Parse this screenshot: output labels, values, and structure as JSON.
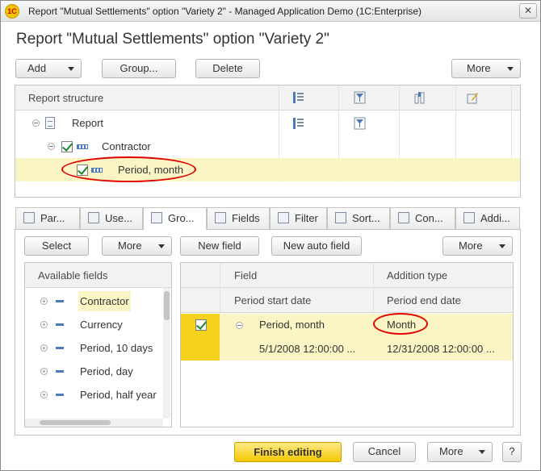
{
  "window": {
    "app_icon": "1С",
    "title": "Report \"Mutual Settlements\" option \"Variety 2\" - Managed Application Demo  (1C:Enterprise)",
    "close_label": "✕"
  },
  "page_title": "Report \"Mutual Settlements\" option \"Variety 2\"",
  "toolbar": {
    "add_label": "Add",
    "group_label": "Group...",
    "delete_label": "Delete",
    "more_label": "More"
  },
  "structure": {
    "header": "Report structure",
    "rows": [
      {
        "label": "Report"
      },
      {
        "label": "Contractor"
      },
      {
        "label": "Period, month"
      }
    ]
  },
  "tabs": [
    {
      "label": "Par..."
    },
    {
      "label": "Use..."
    },
    {
      "label": "Gro..."
    },
    {
      "label": "Fields"
    },
    {
      "label": "Filter"
    },
    {
      "label": "Sort..."
    },
    {
      "label": "Con..."
    },
    {
      "label": "Addi..."
    }
  ],
  "left_toolbar": {
    "select_label": "Select",
    "more_label": "More"
  },
  "available": {
    "header": "Available fields",
    "items": [
      "Contractor",
      "Currency",
      "Period, 10 days",
      "Period, day",
      "Period, half year"
    ]
  },
  "right_toolbar": {
    "new_field_label": "New field",
    "new_auto_label": "New auto field",
    "more_label": "More"
  },
  "grouping_table": {
    "col_field": "Field",
    "col_addition": "Addition type",
    "subheader": {
      "field": "Period start date",
      "addition": "Period end date"
    },
    "row": {
      "field": "Period, month",
      "addition": "Month",
      "start": "5/1/2008 12:00:00 ...",
      "end": "12/31/2008 12:00:00 ..."
    }
  },
  "footer": {
    "finish_label": "Finish editing",
    "cancel_label": "Cancel",
    "more_label": "More",
    "help_label": "?"
  },
  "colors": {
    "accent_yellow": "#fbf4c4",
    "finish_button": "#f5c800",
    "highlight_oval": "#e00000",
    "checkmark": "#1a8a2a"
  }
}
